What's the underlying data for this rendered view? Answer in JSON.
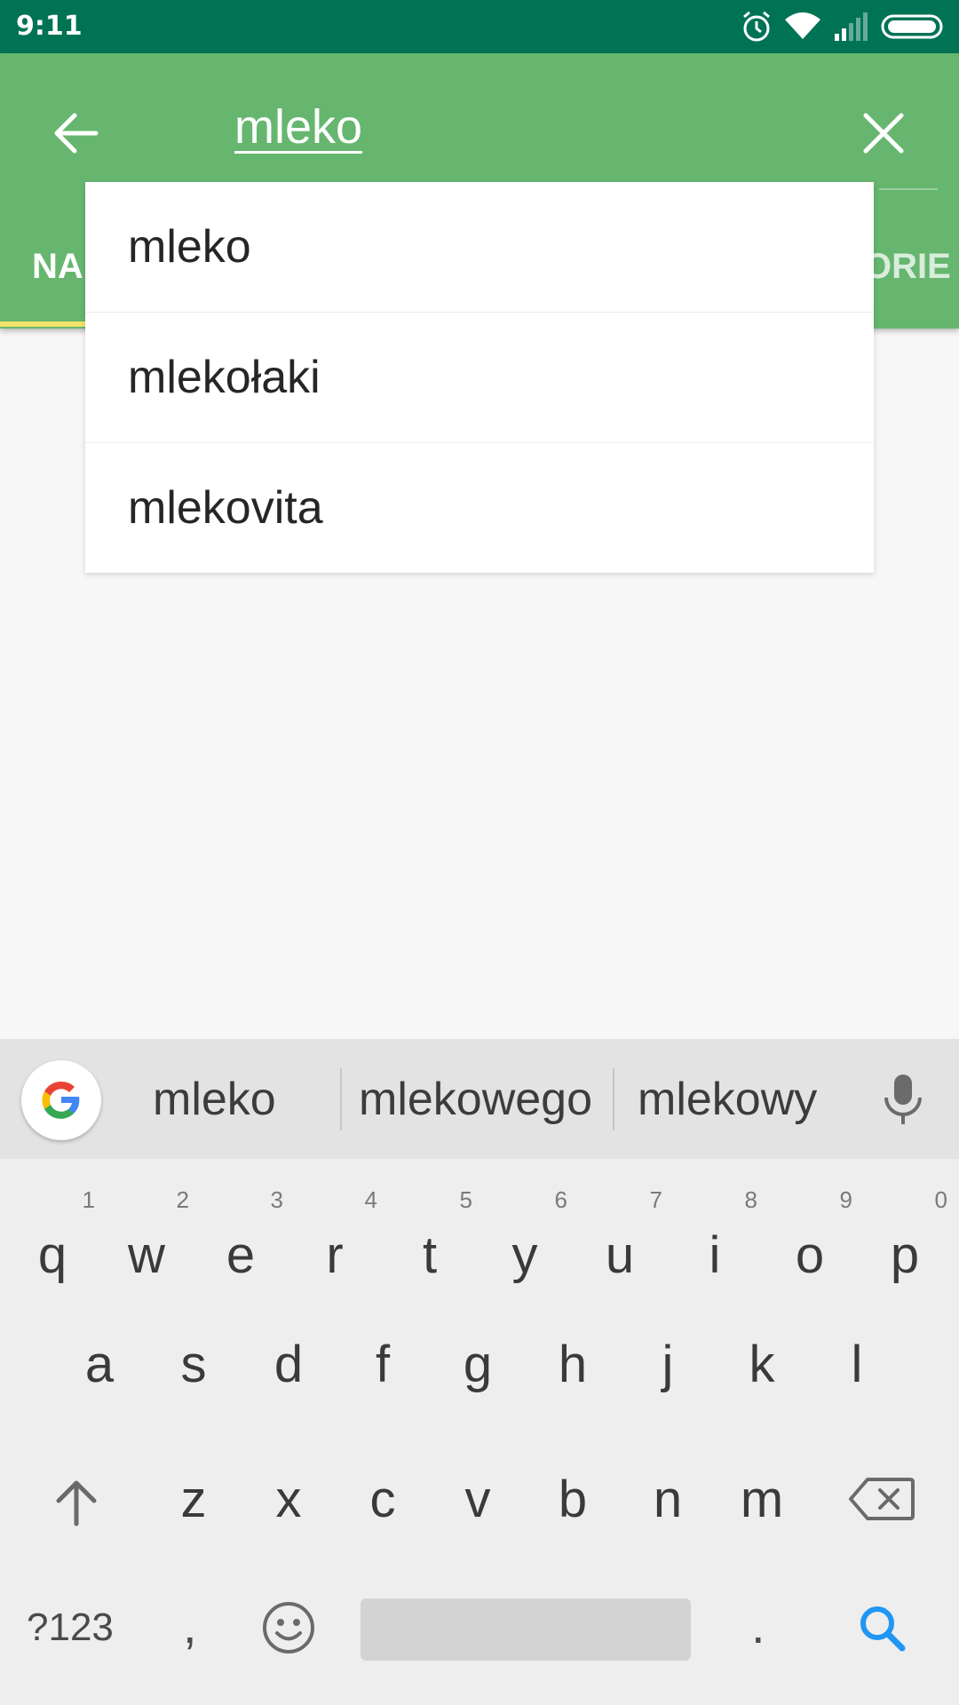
{
  "status_bar": {
    "time": "9:11",
    "icons": [
      "alarm-icon",
      "wifi-icon",
      "signal-icon",
      "battery-icon"
    ],
    "bg_color": "#007355"
  },
  "app_bar": {
    "bg_color": "#66b66f",
    "search_query": "mleko",
    "back_icon": "arrow-left-icon",
    "clear_icon": "close-icon",
    "tabs": {
      "left_visible": "NA",
      "right_visible": "ORIE"
    },
    "indicator_color": "#f3e26b"
  },
  "suggestions": [
    {
      "label": "mleko"
    },
    {
      "label": "mlekołaki"
    },
    {
      "label": "mlekovita"
    }
  ],
  "keyboard": {
    "word_suggestions": [
      "mleko",
      "mlekowego",
      "mlekowy"
    ],
    "row1": [
      {
        "key": "q",
        "hint": "1"
      },
      {
        "key": "w",
        "hint": "2"
      },
      {
        "key": "e",
        "hint": "3"
      },
      {
        "key": "r",
        "hint": "4"
      },
      {
        "key": "t",
        "hint": "5"
      },
      {
        "key": "y",
        "hint": "6"
      },
      {
        "key": "u",
        "hint": "7"
      },
      {
        "key": "i",
        "hint": "8"
      },
      {
        "key": "o",
        "hint": "9"
      },
      {
        "key": "p",
        "hint": "0"
      }
    ],
    "row2": [
      "a",
      "s",
      "d",
      "f",
      "g",
      "h",
      "j",
      "k",
      "l"
    ],
    "row3": [
      "z",
      "x",
      "c",
      "v",
      "b",
      "n",
      "m"
    ],
    "symbols_label": "?123",
    "comma": ",",
    "period": ".",
    "action_color": "#2196f3"
  }
}
